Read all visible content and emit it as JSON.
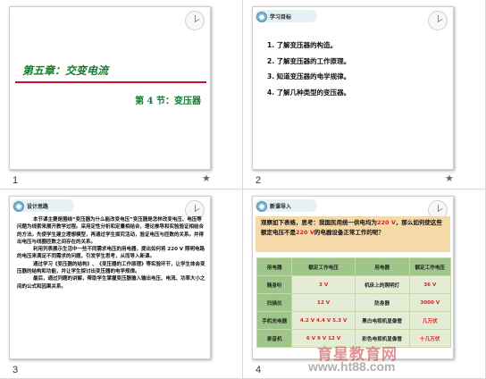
{
  "slides": [
    {
      "number": "1",
      "chapter_title": "第五章：交变电流",
      "section_title": "第 4 节：变压器"
    },
    {
      "number": "2",
      "header": "学习目标",
      "objectives": [
        "1. 了解变压器的构造。",
        "2. 了解变压器的工作原理。",
        "3. 知道变压器的电学规律。",
        "4. 了解几种类型的变压器。"
      ]
    },
    {
      "number": "3",
      "header": "设计思路",
      "paragraphs": [
        "本节课主要是围绕“变压器为什么能改变电压”变压器是怎样改变电压、电压等问题为线索来展开教学过程。采用定性分析和定量相结合，理论推导和实验验证相结合的方法。先使学生建立理想模型，再通过学生探究活动，验证电压与匝数的关系。并得出电压与线圈匝数之间存在的关系。",
        "利用列表展示生活中一些不同需求电压的用电器，提出如何将 220 V 照明电路的电压来满足不同需求的问题，引发学生思考，从而导入新课。",
        "通过学习《变压器的结构》、《变压器的工作原理》等实验环节，让学生体会变压器的结构和功能，并让学生探讨出变压器的电学规律。",
        "最后，通过列题的讲解，帮助学生掌握变压器输入输出电压、电流、功率大小之间的公式和因果关系。"
      ]
    },
    {
      "number": "4",
      "header": "新课导入",
      "question_prefix": "观察如下表格，思考：我国民用统一供电均为",
      "question_voltage_1": "220 V",
      "question_middle": "，那么如何使这些额定电压不是",
      "question_voltage_2": "220 V",
      "question_suffix": "的电器设备正常工作的呢？",
      "table": [
        [
          "用电器",
          "额定工作电压",
          "用电器",
          "额定工作电压"
        ],
        [
          "随身听",
          "3 V",
          "机床上的照明灯",
          "36 V"
        ],
        [
          "扫描仪",
          "12 V",
          "防身器",
          "3000 V"
        ],
        [
          "手机充电器",
          "4.2 V 4.4 V 5.3 V",
          "黑白电视机显像管",
          "几万伏"
        ],
        [
          "录音机",
          "6 V 9 V 12 V",
          "彩色电视机显像管",
          "十几万伏"
        ]
      ]
    }
  ],
  "watermark": {
    "text": "育星教育网",
    "url": "www.ht88.com"
  }
}
